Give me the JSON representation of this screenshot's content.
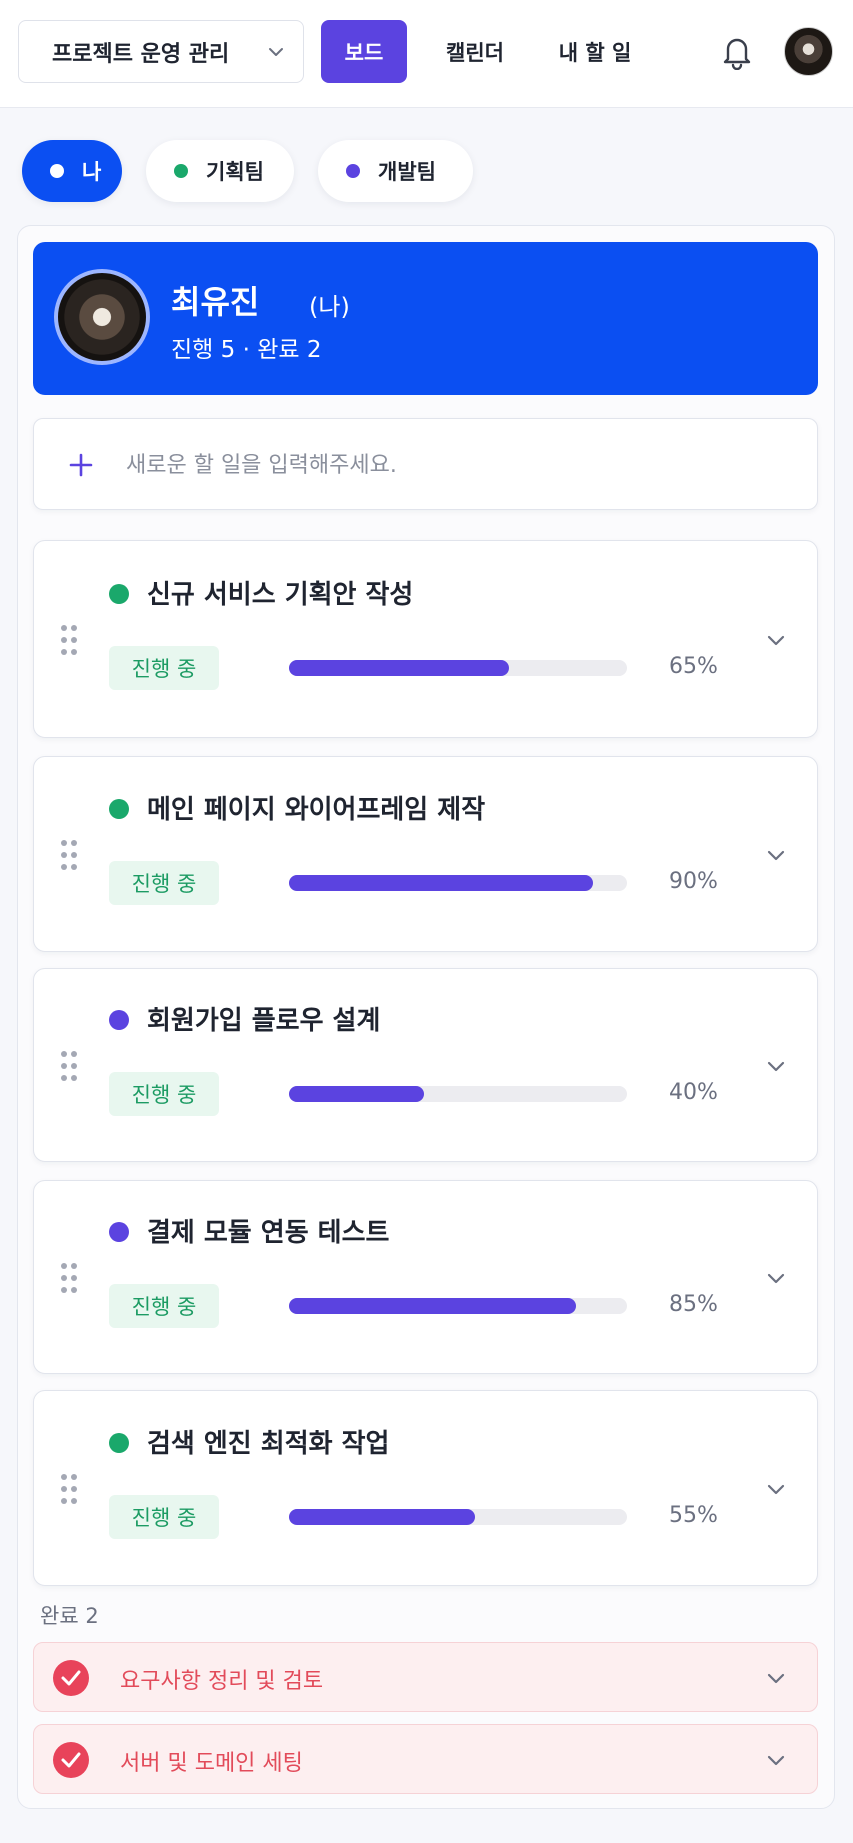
{
  "header": {
    "project_select": "프로젝트 운영 관리",
    "tabs": [
      {
        "label": "보드",
        "active": true
      },
      {
        "label": "캘린더",
        "active": false
      },
      {
        "label": "내 할 일",
        "active": false
      }
    ],
    "icons": [
      "chevron-down-icon",
      "bell-icon",
      "avatar"
    ]
  },
  "filters": [
    {
      "label": "나",
      "dot_color": "#ffffff",
      "active": true
    },
    {
      "label": "기획팀",
      "dot_color": "#1aa86b",
      "active": false
    },
    {
      "label": "개발팀",
      "dot_color": "#5b43e0",
      "active": false
    }
  ],
  "profile": {
    "name": "최유진",
    "me_label": "(나)",
    "stats": "진행 5 · 완료 2"
  },
  "add_task": {
    "placeholder": "새로운 할 일을 입력해주세요.",
    "icon": "plus-icon"
  },
  "tasks": [
    {
      "title": "신규 서비스 기획안 작성",
      "status": "진행 중",
      "progress": 65,
      "progress_label": "65%",
      "dot_color": "#1aa86b"
    },
    {
      "title": "메인 페이지 와이어프레임 제작",
      "status": "진행 중",
      "progress": 90,
      "progress_label": "90%",
      "dot_color": "#1aa86b"
    },
    {
      "title": "회원가입 플로우 설계",
      "status": "진행 중",
      "progress": 40,
      "progress_label": "40%",
      "dot_color": "#5b43e0"
    },
    {
      "title": "결제 모듈 연동 테스트",
      "status": "진행 중",
      "progress": 85,
      "progress_label": "85%",
      "dot_color": "#5b43e0"
    },
    {
      "title": "검색 엔진 최적화 작업",
      "status": "진행 중",
      "progress": 55,
      "progress_label": "55%",
      "dot_color": "#1aa86b"
    }
  ],
  "done": {
    "label": "완료 2",
    "items": [
      {
        "title": "요구사항 정리 및 검토"
      },
      {
        "title": "서버 및 도메인 세팅"
      }
    ]
  },
  "colors": {
    "brand_blue": "#0b4ff2",
    "accent_purple": "#5b43e0",
    "status_green": "#1c9b63",
    "done_red": "#e24b5a"
  }
}
